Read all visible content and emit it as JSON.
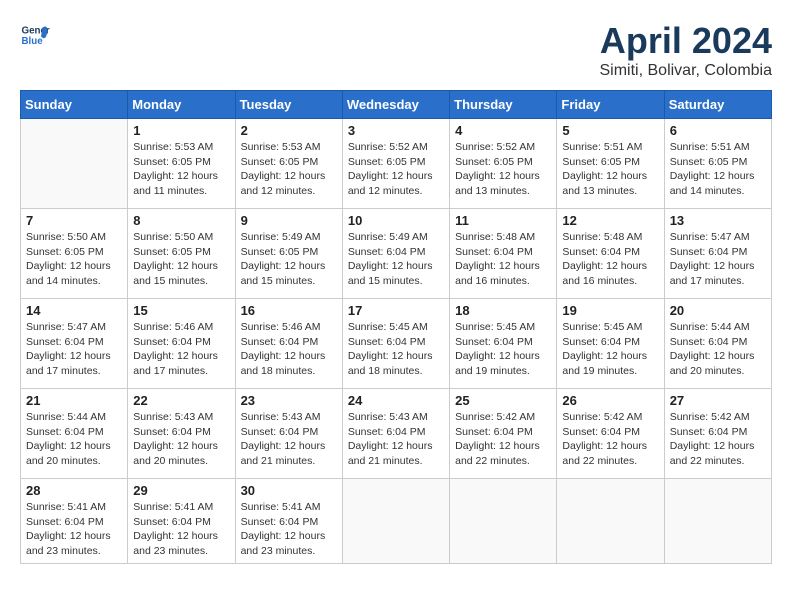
{
  "header": {
    "logo_line1": "General",
    "logo_line2": "Blue",
    "month": "April 2024",
    "location": "Simiti, Bolivar, Colombia"
  },
  "weekdays": [
    "Sunday",
    "Monday",
    "Tuesday",
    "Wednesday",
    "Thursday",
    "Friday",
    "Saturday"
  ],
  "weeks": [
    [
      {
        "day": "",
        "empty": true
      },
      {
        "day": "1",
        "sunrise": "Sunrise: 5:53 AM",
        "sunset": "Sunset: 6:05 PM",
        "daylight": "Daylight: 12 hours and 11 minutes."
      },
      {
        "day": "2",
        "sunrise": "Sunrise: 5:53 AM",
        "sunset": "Sunset: 6:05 PM",
        "daylight": "Daylight: 12 hours and 12 minutes."
      },
      {
        "day": "3",
        "sunrise": "Sunrise: 5:52 AM",
        "sunset": "Sunset: 6:05 PM",
        "daylight": "Daylight: 12 hours and 12 minutes."
      },
      {
        "day": "4",
        "sunrise": "Sunrise: 5:52 AM",
        "sunset": "Sunset: 6:05 PM",
        "daylight": "Daylight: 12 hours and 13 minutes."
      },
      {
        "day": "5",
        "sunrise": "Sunrise: 5:51 AM",
        "sunset": "Sunset: 6:05 PM",
        "daylight": "Daylight: 12 hours and 13 minutes."
      },
      {
        "day": "6",
        "sunrise": "Sunrise: 5:51 AM",
        "sunset": "Sunset: 6:05 PM",
        "daylight": "Daylight: 12 hours and 14 minutes."
      }
    ],
    [
      {
        "day": "7",
        "sunrise": "Sunrise: 5:50 AM",
        "sunset": "Sunset: 6:05 PM",
        "daylight": "Daylight: 12 hours and 14 minutes."
      },
      {
        "day": "8",
        "sunrise": "Sunrise: 5:50 AM",
        "sunset": "Sunset: 6:05 PM",
        "daylight": "Daylight: 12 hours and 15 minutes."
      },
      {
        "day": "9",
        "sunrise": "Sunrise: 5:49 AM",
        "sunset": "Sunset: 6:05 PM",
        "daylight": "Daylight: 12 hours and 15 minutes."
      },
      {
        "day": "10",
        "sunrise": "Sunrise: 5:49 AM",
        "sunset": "Sunset: 6:04 PM",
        "daylight": "Daylight: 12 hours and 15 minutes."
      },
      {
        "day": "11",
        "sunrise": "Sunrise: 5:48 AM",
        "sunset": "Sunset: 6:04 PM",
        "daylight": "Daylight: 12 hours and 16 minutes."
      },
      {
        "day": "12",
        "sunrise": "Sunrise: 5:48 AM",
        "sunset": "Sunset: 6:04 PM",
        "daylight": "Daylight: 12 hours and 16 minutes."
      },
      {
        "day": "13",
        "sunrise": "Sunrise: 5:47 AM",
        "sunset": "Sunset: 6:04 PM",
        "daylight": "Daylight: 12 hours and 17 minutes."
      }
    ],
    [
      {
        "day": "14",
        "sunrise": "Sunrise: 5:47 AM",
        "sunset": "Sunset: 6:04 PM",
        "daylight": "Daylight: 12 hours and 17 minutes."
      },
      {
        "day": "15",
        "sunrise": "Sunrise: 5:46 AM",
        "sunset": "Sunset: 6:04 PM",
        "daylight": "Daylight: 12 hours and 17 minutes."
      },
      {
        "day": "16",
        "sunrise": "Sunrise: 5:46 AM",
        "sunset": "Sunset: 6:04 PM",
        "daylight": "Daylight: 12 hours and 18 minutes."
      },
      {
        "day": "17",
        "sunrise": "Sunrise: 5:45 AM",
        "sunset": "Sunset: 6:04 PM",
        "daylight": "Daylight: 12 hours and 18 minutes."
      },
      {
        "day": "18",
        "sunrise": "Sunrise: 5:45 AM",
        "sunset": "Sunset: 6:04 PM",
        "daylight": "Daylight: 12 hours and 19 minutes."
      },
      {
        "day": "19",
        "sunrise": "Sunrise: 5:45 AM",
        "sunset": "Sunset: 6:04 PM",
        "daylight": "Daylight: 12 hours and 19 minutes."
      },
      {
        "day": "20",
        "sunrise": "Sunrise: 5:44 AM",
        "sunset": "Sunset: 6:04 PM",
        "daylight": "Daylight: 12 hours and 20 minutes."
      }
    ],
    [
      {
        "day": "21",
        "sunrise": "Sunrise: 5:44 AM",
        "sunset": "Sunset: 6:04 PM",
        "daylight": "Daylight: 12 hours and 20 minutes."
      },
      {
        "day": "22",
        "sunrise": "Sunrise: 5:43 AM",
        "sunset": "Sunset: 6:04 PM",
        "daylight": "Daylight: 12 hours and 20 minutes."
      },
      {
        "day": "23",
        "sunrise": "Sunrise: 5:43 AM",
        "sunset": "Sunset: 6:04 PM",
        "daylight": "Daylight: 12 hours and 21 minutes."
      },
      {
        "day": "24",
        "sunrise": "Sunrise: 5:43 AM",
        "sunset": "Sunset: 6:04 PM",
        "daylight": "Daylight: 12 hours and 21 minutes."
      },
      {
        "day": "25",
        "sunrise": "Sunrise: 5:42 AM",
        "sunset": "Sunset: 6:04 PM",
        "daylight": "Daylight: 12 hours and 22 minutes."
      },
      {
        "day": "26",
        "sunrise": "Sunrise: 5:42 AM",
        "sunset": "Sunset: 6:04 PM",
        "daylight": "Daylight: 12 hours and 22 minutes."
      },
      {
        "day": "27",
        "sunrise": "Sunrise: 5:42 AM",
        "sunset": "Sunset: 6:04 PM",
        "daylight": "Daylight: 12 hours and 22 minutes."
      }
    ],
    [
      {
        "day": "28",
        "sunrise": "Sunrise: 5:41 AM",
        "sunset": "Sunset: 6:04 PM",
        "daylight": "Daylight: 12 hours and 23 minutes."
      },
      {
        "day": "29",
        "sunrise": "Sunrise: 5:41 AM",
        "sunset": "Sunset: 6:04 PM",
        "daylight": "Daylight: 12 hours and 23 minutes."
      },
      {
        "day": "30",
        "sunrise": "Sunrise: 5:41 AM",
        "sunset": "Sunset: 6:04 PM",
        "daylight": "Daylight: 12 hours and 23 minutes."
      },
      {
        "day": "",
        "empty": true
      },
      {
        "day": "",
        "empty": true
      },
      {
        "day": "",
        "empty": true
      },
      {
        "day": "",
        "empty": true
      }
    ]
  ]
}
